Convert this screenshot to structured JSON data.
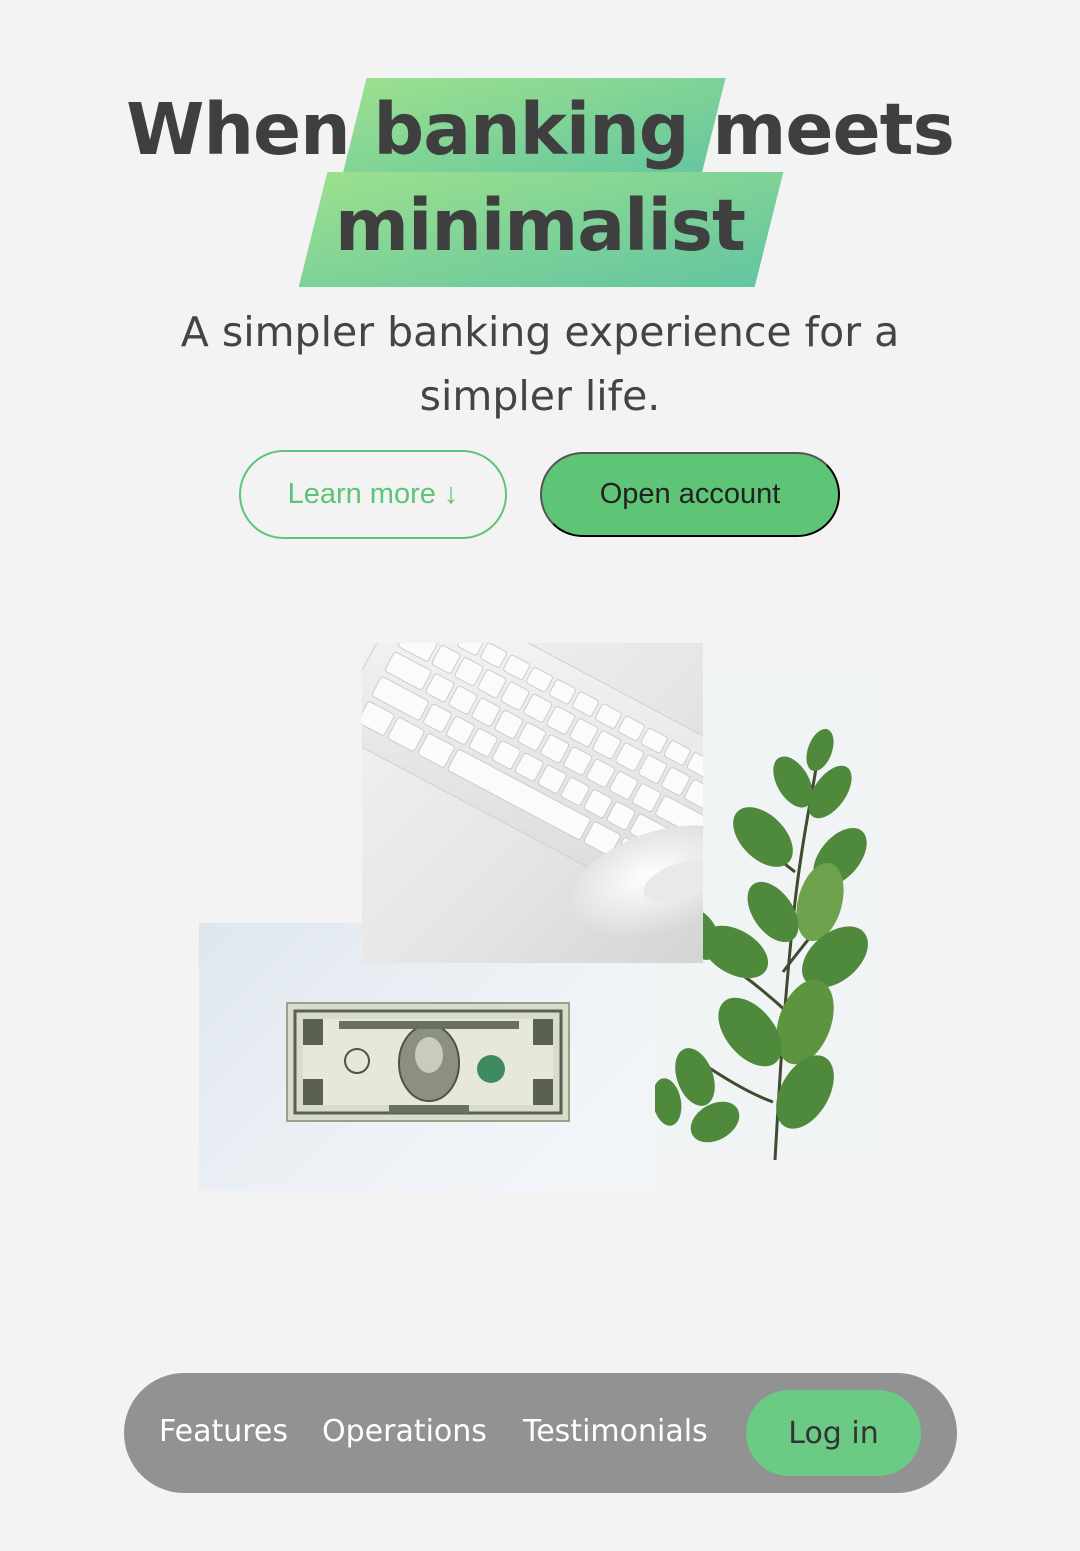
{
  "hero": {
    "title_word_1": "When",
    "title_highlight_1": "banking",
    "title_word_2": "meets",
    "title_highlight_2": "minimalist",
    "subtitle": "A simpler banking experience for a simpler life."
  },
  "buttons": {
    "learn_more": "Learn more ↓",
    "open_account": "Open account"
  },
  "images": {
    "keyboard": "keyboard-mouse-photo",
    "plant": "eucalyptus-plant-photo",
    "dollar": "dollar-bill-photo"
  },
  "nav": {
    "items": [
      {
        "label": "Features"
      },
      {
        "label": "Operations"
      },
      {
        "label": "Testimonials"
      }
    ],
    "login_label": "Log in"
  },
  "colors": {
    "accent": "#5ec576",
    "highlight_gradient_start": "#9be08e",
    "highlight_gradient_end": "#63c5a0",
    "nav_background": "#929292",
    "page_background": "#f3f3f3",
    "heading_text": "#3f3f3f"
  }
}
